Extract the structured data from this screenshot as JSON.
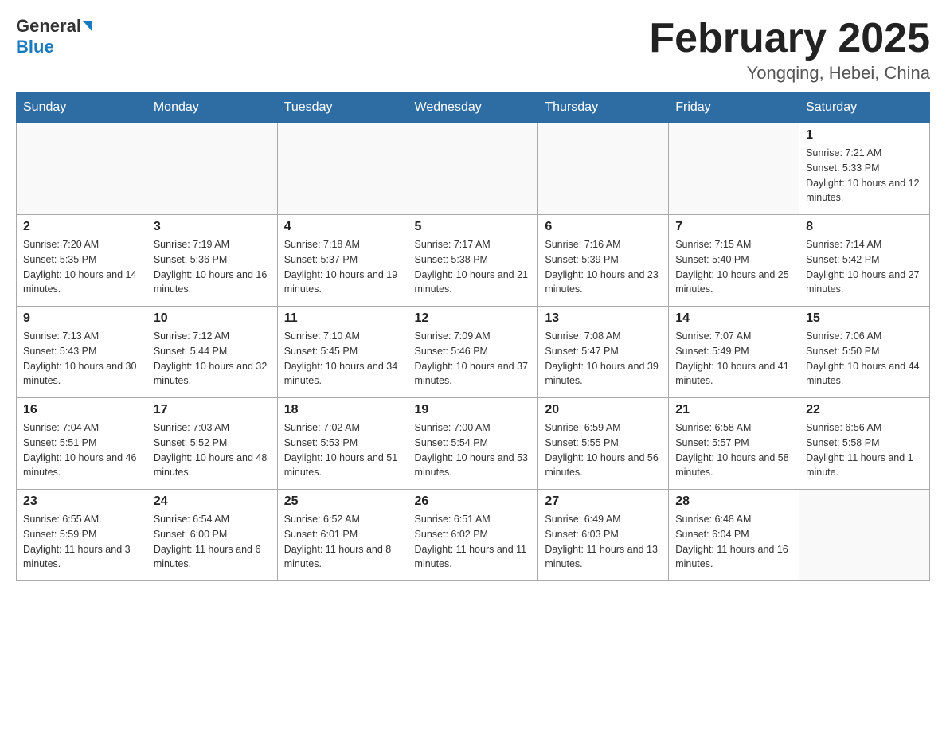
{
  "header": {
    "logo": {
      "general": "General",
      "blue": "Blue"
    },
    "title": "February 2025",
    "location": "Yongqing, Hebei, China"
  },
  "days_of_week": [
    "Sunday",
    "Monday",
    "Tuesday",
    "Wednesday",
    "Thursday",
    "Friday",
    "Saturday"
  ],
  "weeks": [
    [
      {
        "day": "",
        "info": ""
      },
      {
        "day": "",
        "info": ""
      },
      {
        "day": "",
        "info": ""
      },
      {
        "day": "",
        "info": ""
      },
      {
        "day": "",
        "info": ""
      },
      {
        "day": "",
        "info": ""
      },
      {
        "day": "1",
        "info": "Sunrise: 7:21 AM\nSunset: 5:33 PM\nDaylight: 10 hours and 12 minutes."
      }
    ],
    [
      {
        "day": "2",
        "info": "Sunrise: 7:20 AM\nSunset: 5:35 PM\nDaylight: 10 hours and 14 minutes."
      },
      {
        "day": "3",
        "info": "Sunrise: 7:19 AM\nSunset: 5:36 PM\nDaylight: 10 hours and 16 minutes."
      },
      {
        "day": "4",
        "info": "Sunrise: 7:18 AM\nSunset: 5:37 PM\nDaylight: 10 hours and 19 minutes."
      },
      {
        "day": "5",
        "info": "Sunrise: 7:17 AM\nSunset: 5:38 PM\nDaylight: 10 hours and 21 minutes."
      },
      {
        "day": "6",
        "info": "Sunrise: 7:16 AM\nSunset: 5:39 PM\nDaylight: 10 hours and 23 minutes."
      },
      {
        "day": "7",
        "info": "Sunrise: 7:15 AM\nSunset: 5:40 PM\nDaylight: 10 hours and 25 minutes."
      },
      {
        "day": "8",
        "info": "Sunrise: 7:14 AM\nSunset: 5:42 PM\nDaylight: 10 hours and 27 minutes."
      }
    ],
    [
      {
        "day": "9",
        "info": "Sunrise: 7:13 AM\nSunset: 5:43 PM\nDaylight: 10 hours and 30 minutes."
      },
      {
        "day": "10",
        "info": "Sunrise: 7:12 AM\nSunset: 5:44 PM\nDaylight: 10 hours and 32 minutes."
      },
      {
        "day": "11",
        "info": "Sunrise: 7:10 AM\nSunset: 5:45 PM\nDaylight: 10 hours and 34 minutes."
      },
      {
        "day": "12",
        "info": "Sunrise: 7:09 AM\nSunset: 5:46 PM\nDaylight: 10 hours and 37 minutes."
      },
      {
        "day": "13",
        "info": "Sunrise: 7:08 AM\nSunset: 5:47 PM\nDaylight: 10 hours and 39 minutes."
      },
      {
        "day": "14",
        "info": "Sunrise: 7:07 AM\nSunset: 5:49 PM\nDaylight: 10 hours and 41 minutes."
      },
      {
        "day": "15",
        "info": "Sunrise: 7:06 AM\nSunset: 5:50 PM\nDaylight: 10 hours and 44 minutes."
      }
    ],
    [
      {
        "day": "16",
        "info": "Sunrise: 7:04 AM\nSunset: 5:51 PM\nDaylight: 10 hours and 46 minutes."
      },
      {
        "day": "17",
        "info": "Sunrise: 7:03 AM\nSunset: 5:52 PM\nDaylight: 10 hours and 48 minutes."
      },
      {
        "day": "18",
        "info": "Sunrise: 7:02 AM\nSunset: 5:53 PM\nDaylight: 10 hours and 51 minutes."
      },
      {
        "day": "19",
        "info": "Sunrise: 7:00 AM\nSunset: 5:54 PM\nDaylight: 10 hours and 53 minutes."
      },
      {
        "day": "20",
        "info": "Sunrise: 6:59 AM\nSunset: 5:55 PM\nDaylight: 10 hours and 56 minutes."
      },
      {
        "day": "21",
        "info": "Sunrise: 6:58 AM\nSunset: 5:57 PM\nDaylight: 10 hours and 58 minutes."
      },
      {
        "day": "22",
        "info": "Sunrise: 6:56 AM\nSunset: 5:58 PM\nDaylight: 11 hours and 1 minute."
      }
    ],
    [
      {
        "day": "23",
        "info": "Sunrise: 6:55 AM\nSunset: 5:59 PM\nDaylight: 11 hours and 3 minutes."
      },
      {
        "day": "24",
        "info": "Sunrise: 6:54 AM\nSunset: 6:00 PM\nDaylight: 11 hours and 6 minutes."
      },
      {
        "day": "25",
        "info": "Sunrise: 6:52 AM\nSunset: 6:01 PM\nDaylight: 11 hours and 8 minutes."
      },
      {
        "day": "26",
        "info": "Sunrise: 6:51 AM\nSunset: 6:02 PM\nDaylight: 11 hours and 11 minutes."
      },
      {
        "day": "27",
        "info": "Sunrise: 6:49 AM\nSunset: 6:03 PM\nDaylight: 11 hours and 13 minutes."
      },
      {
        "day": "28",
        "info": "Sunrise: 6:48 AM\nSunset: 6:04 PM\nDaylight: 11 hours and 16 minutes."
      },
      {
        "day": "",
        "info": ""
      }
    ]
  ]
}
